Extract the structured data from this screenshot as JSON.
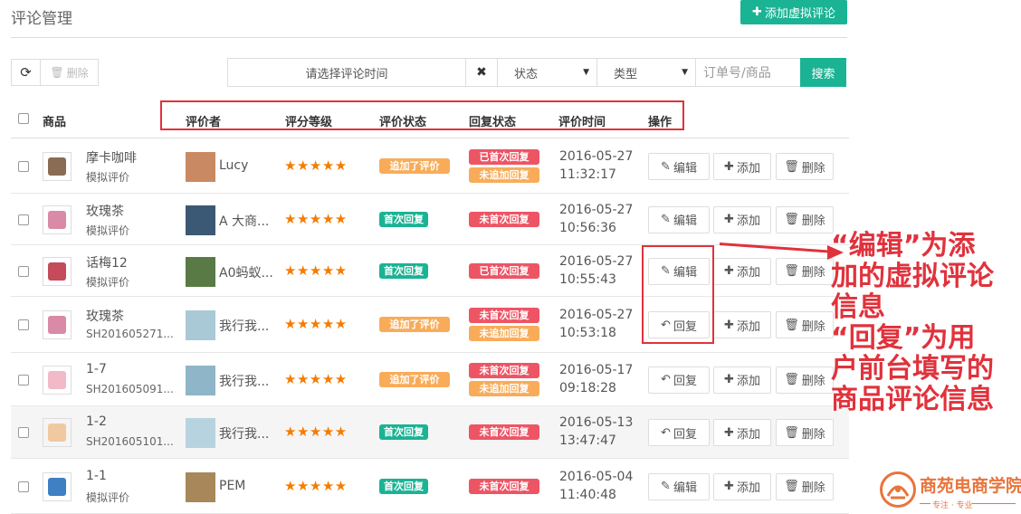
{
  "page": {
    "title": "评论管理",
    "add_button": "添加虚拟评论"
  },
  "toolbar": {
    "delete_label": "删除",
    "date_placeholder": "请选择评论时间",
    "status_select": "状态",
    "type_select": "类型",
    "order_placeholder": "订单号/商品",
    "search_label": "搜索"
  },
  "table": {
    "headers": {
      "product": "商品",
      "reviewer": "评价者",
      "rating": "评分等级",
      "review_status": "评价状态",
      "reply_status": "回复状态",
      "review_time": "评价时间",
      "actions": "操作"
    },
    "rows": [
      {
        "product": "摩卡咖啡",
        "sub": "模拟评价",
        "reviewer": "Lucy",
        "stars": "★★★★★",
        "review_status": "追加了评价",
        "review_status_color": "#f8ac59",
        "reply_status": [
          "已首次回复",
          "未追加回复"
        ],
        "date": "2016-05-27",
        "time": "11:32:17",
        "action": "编辑",
        "action_icon": "edit-icon",
        "add": "添加",
        "delete": "删除"
      },
      {
        "product": "玫瑰茶",
        "sub": "模拟评价",
        "reviewer": "A 大商...",
        "stars": "★★★★★",
        "review_status": "首次回复",
        "review_status_color": "#1ab394",
        "reply_status": [
          "未首次回复"
        ],
        "date": "2016-05-27",
        "time": "10:56:36",
        "action": "编辑",
        "action_icon": "edit-icon",
        "add": "添加",
        "delete": "删除"
      },
      {
        "product": "话梅12",
        "sub": "模拟评价",
        "reviewer": "A0蚂蚁...",
        "stars": "★★★★★",
        "review_status": "首次回复",
        "review_status_color": "#1ab394",
        "reply_status": [
          "已首次回复"
        ],
        "date": "2016-05-27",
        "time": "10:55:43",
        "action": "编辑",
        "action_icon": "edit-icon",
        "add": "添加",
        "delete": "删除"
      },
      {
        "product": "玫瑰茶",
        "sub": "SH201605271...",
        "reviewer": "我行我...",
        "stars": "★★★★★",
        "review_status": "追加了评价",
        "review_status_color": "#f8ac59",
        "reply_status": [
          "未首次回复",
          "未追加回复"
        ],
        "date": "2016-05-27",
        "time": "10:53:18",
        "action": "回复",
        "action_icon": "reply-icon",
        "add": "添加",
        "delete": "删除"
      },
      {
        "product": "1-7",
        "sub": "SH201605091...",
        "reviewer": "我行我...",
        "stars": "★★★★★",
        "review_status": "追加了评价",
        "review_status_color": "#f8ac59",
        "reply_status": [
          "未首次回复",
          "未追加回复"
        ],
        "date": "2016-05-17",
        "time": "09:18:28",
        "action": "回复",
        "action_icon": "reply-icon",
        "add": "添加",
        "delete": "删除"
      },
      {
        "product": "1-2",
        "sub": "SH201605101...",
        "reviewer": "我行我...",
        "stars": "★★★★★",
        "review_status": "首次回复",
        "review_status_color": "#1ab394",
        "reply_status": [
          "未首次回复"
        ],
        "date": "2016-05-13",
        "time": "13:47:47",
        "action": "回复",
        "action_icon": "reply-icon",
        "add": "添加",
        "delete": "删除"
      },
      {
        "product": "1-1",
        "sub": "模拟评价",
        "reviewer": "PEM",
        "stars": "★★★★★",
        "review_status": "首次回复",
        "review_status_color": "#1ab394",
        "reply_status": [
          "未首次回复"
        ],
        "date": "2016-05-04",
        "time": "11:40:48",
        "action": "编辑",
        "action_icon": "edit-icon",
        "add": "添加",
        "delete": "删除"
      }
    ]
  },
  "annotation": {
    "lines": [
      "“编辑”为添",
      "加的虚拟评论",
      "信息",
      "“回复”为用",
      "户前台填写的",
      "商品评论信息"
    ]
  },
  "logo": {
    "name": "商苑电商学院",
    "tagline": "专注 · 专业"
  },
  "colors": {
    "accent": "#1ab394",
    "highlight": "#e0323c",
    "star": "#f57c00"
  }
}
